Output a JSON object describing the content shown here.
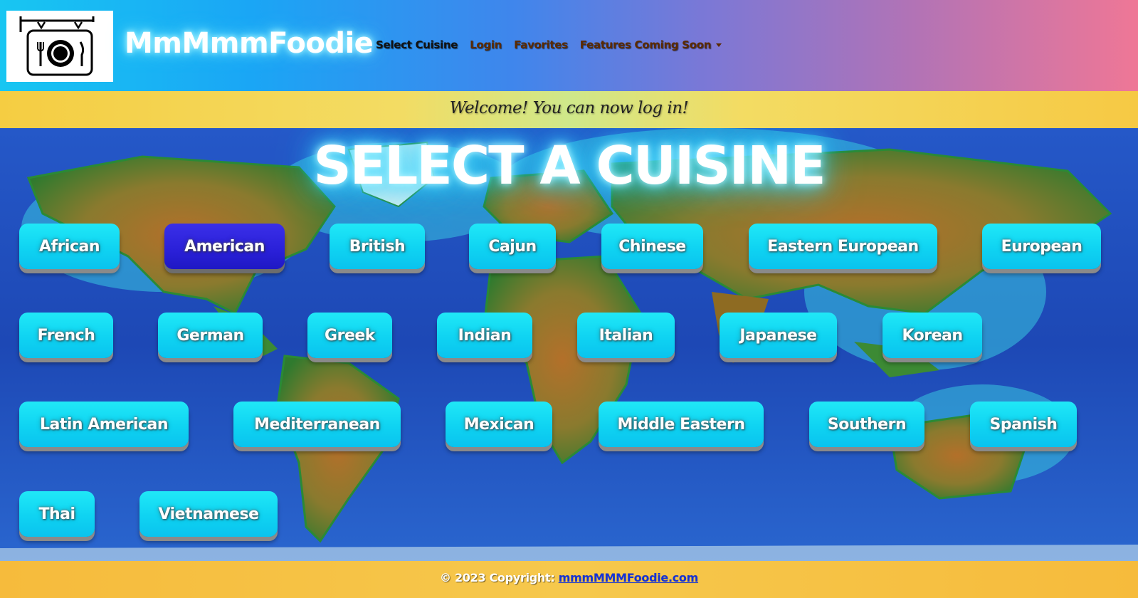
{
  "navbar": {
    "brand": "MmMmmFoodie",
    "logo_icon": "restaurant-sign-icon",
    "links": {
      "select_cuisine": "Select Cuisine",
      "login": "Login",
      "favorites": "Favorites",
      "features": "Features Coming Soon"
    }
  },
  "alert": {
    "message": "Welcome! You can now log in!"
  },
  "main": {
    "title": "SELECT A CUISINE",
    "cuisines": {
      "african": "African",
      "american": "American",
      "british": "British",
      "cajun": "Cajun",
      "chinese": "Chinese",
      "eastern_european": "Eastern European",
      "european": "European",
      "french": "French",
      "german": "German",
      "greek": "Greek",
      "indian": "Indian",
      "italian": "Italian",
      "japanese": "Japanese",
      "korean": "Korean",
      "latin_american": "Latin American",
      "mediterranean": "Mediterranean",
      "mexican": "Mexican",
      "middle_eastern": "Middle Eastern",
      "southern": "Southern",
      "spanish": "Spanish",
      "thai": "Thai",
      "vietnamese": "Vietnamese"
    },
    "selected": "American"
  },
  "footer": {
    "text": "© 2023 Copyright: ",
    "link": "mmmMMMFoodie.com"
  },
  "colors": {
    "button": "#0fd3f2",
    "button_active": "#2a20d8",
    "alert_bg": "#f3dc63",
    "footer_bg": "#f6c84c",
    "footer_link": "#1633d6"
  }
}
